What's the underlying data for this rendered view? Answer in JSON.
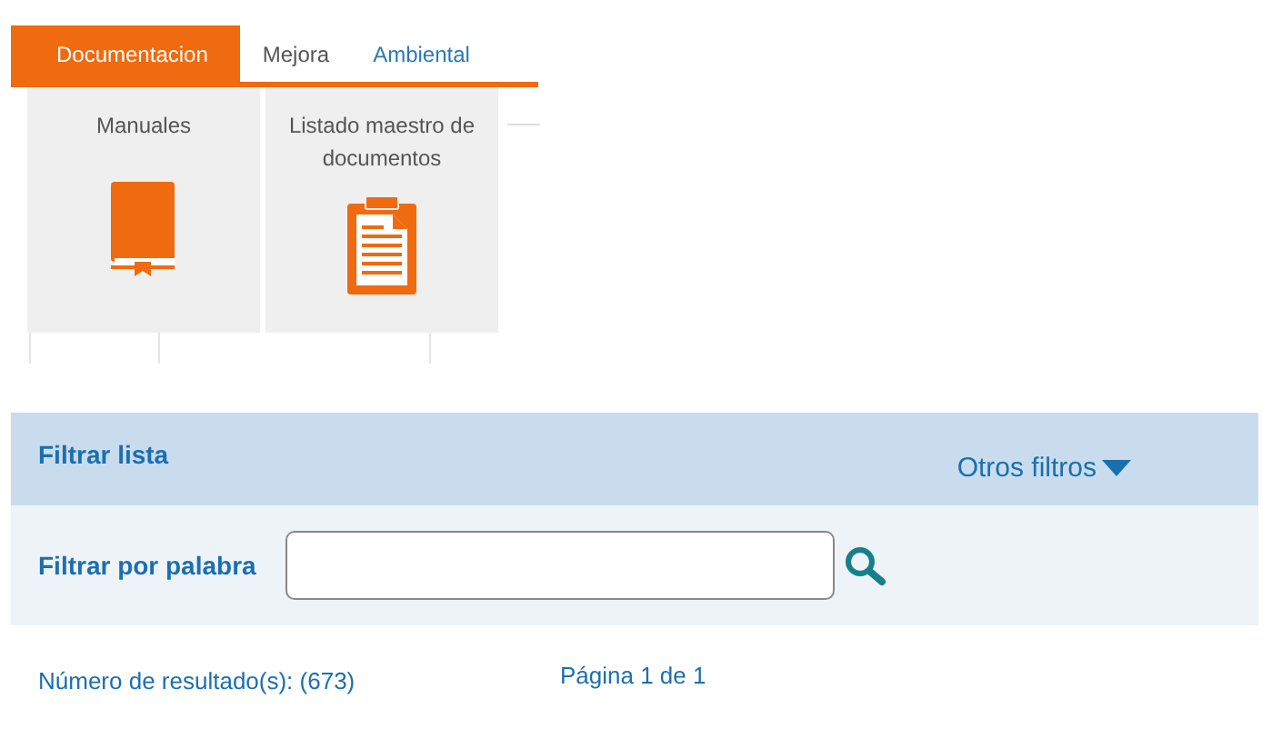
{
  "tabs": [
    {
      "label": "Documentacion",
      "selected": true
    },
    {
      "label": "Mejora",
      "selected": false
    },
    {
      "label": "Ambiental",
      "selected": false
    }
  ],
  "tiles": [
    {
      "label": "Manuales",
      "kind": "book"
    },
    {
      "label": "Listado maestro de documentos",
      "kind": "clipboard"
    }
  ],
  "filter": {
    "title": "Filtrar lista",
    "other_filters": "Otros filtros",
    "word_label": "Filtrar por palabra"
  },
  "results": {
    "count": "Número de resultado(s): (673)",
    "page": "Página 1 de 1"
  }
}
